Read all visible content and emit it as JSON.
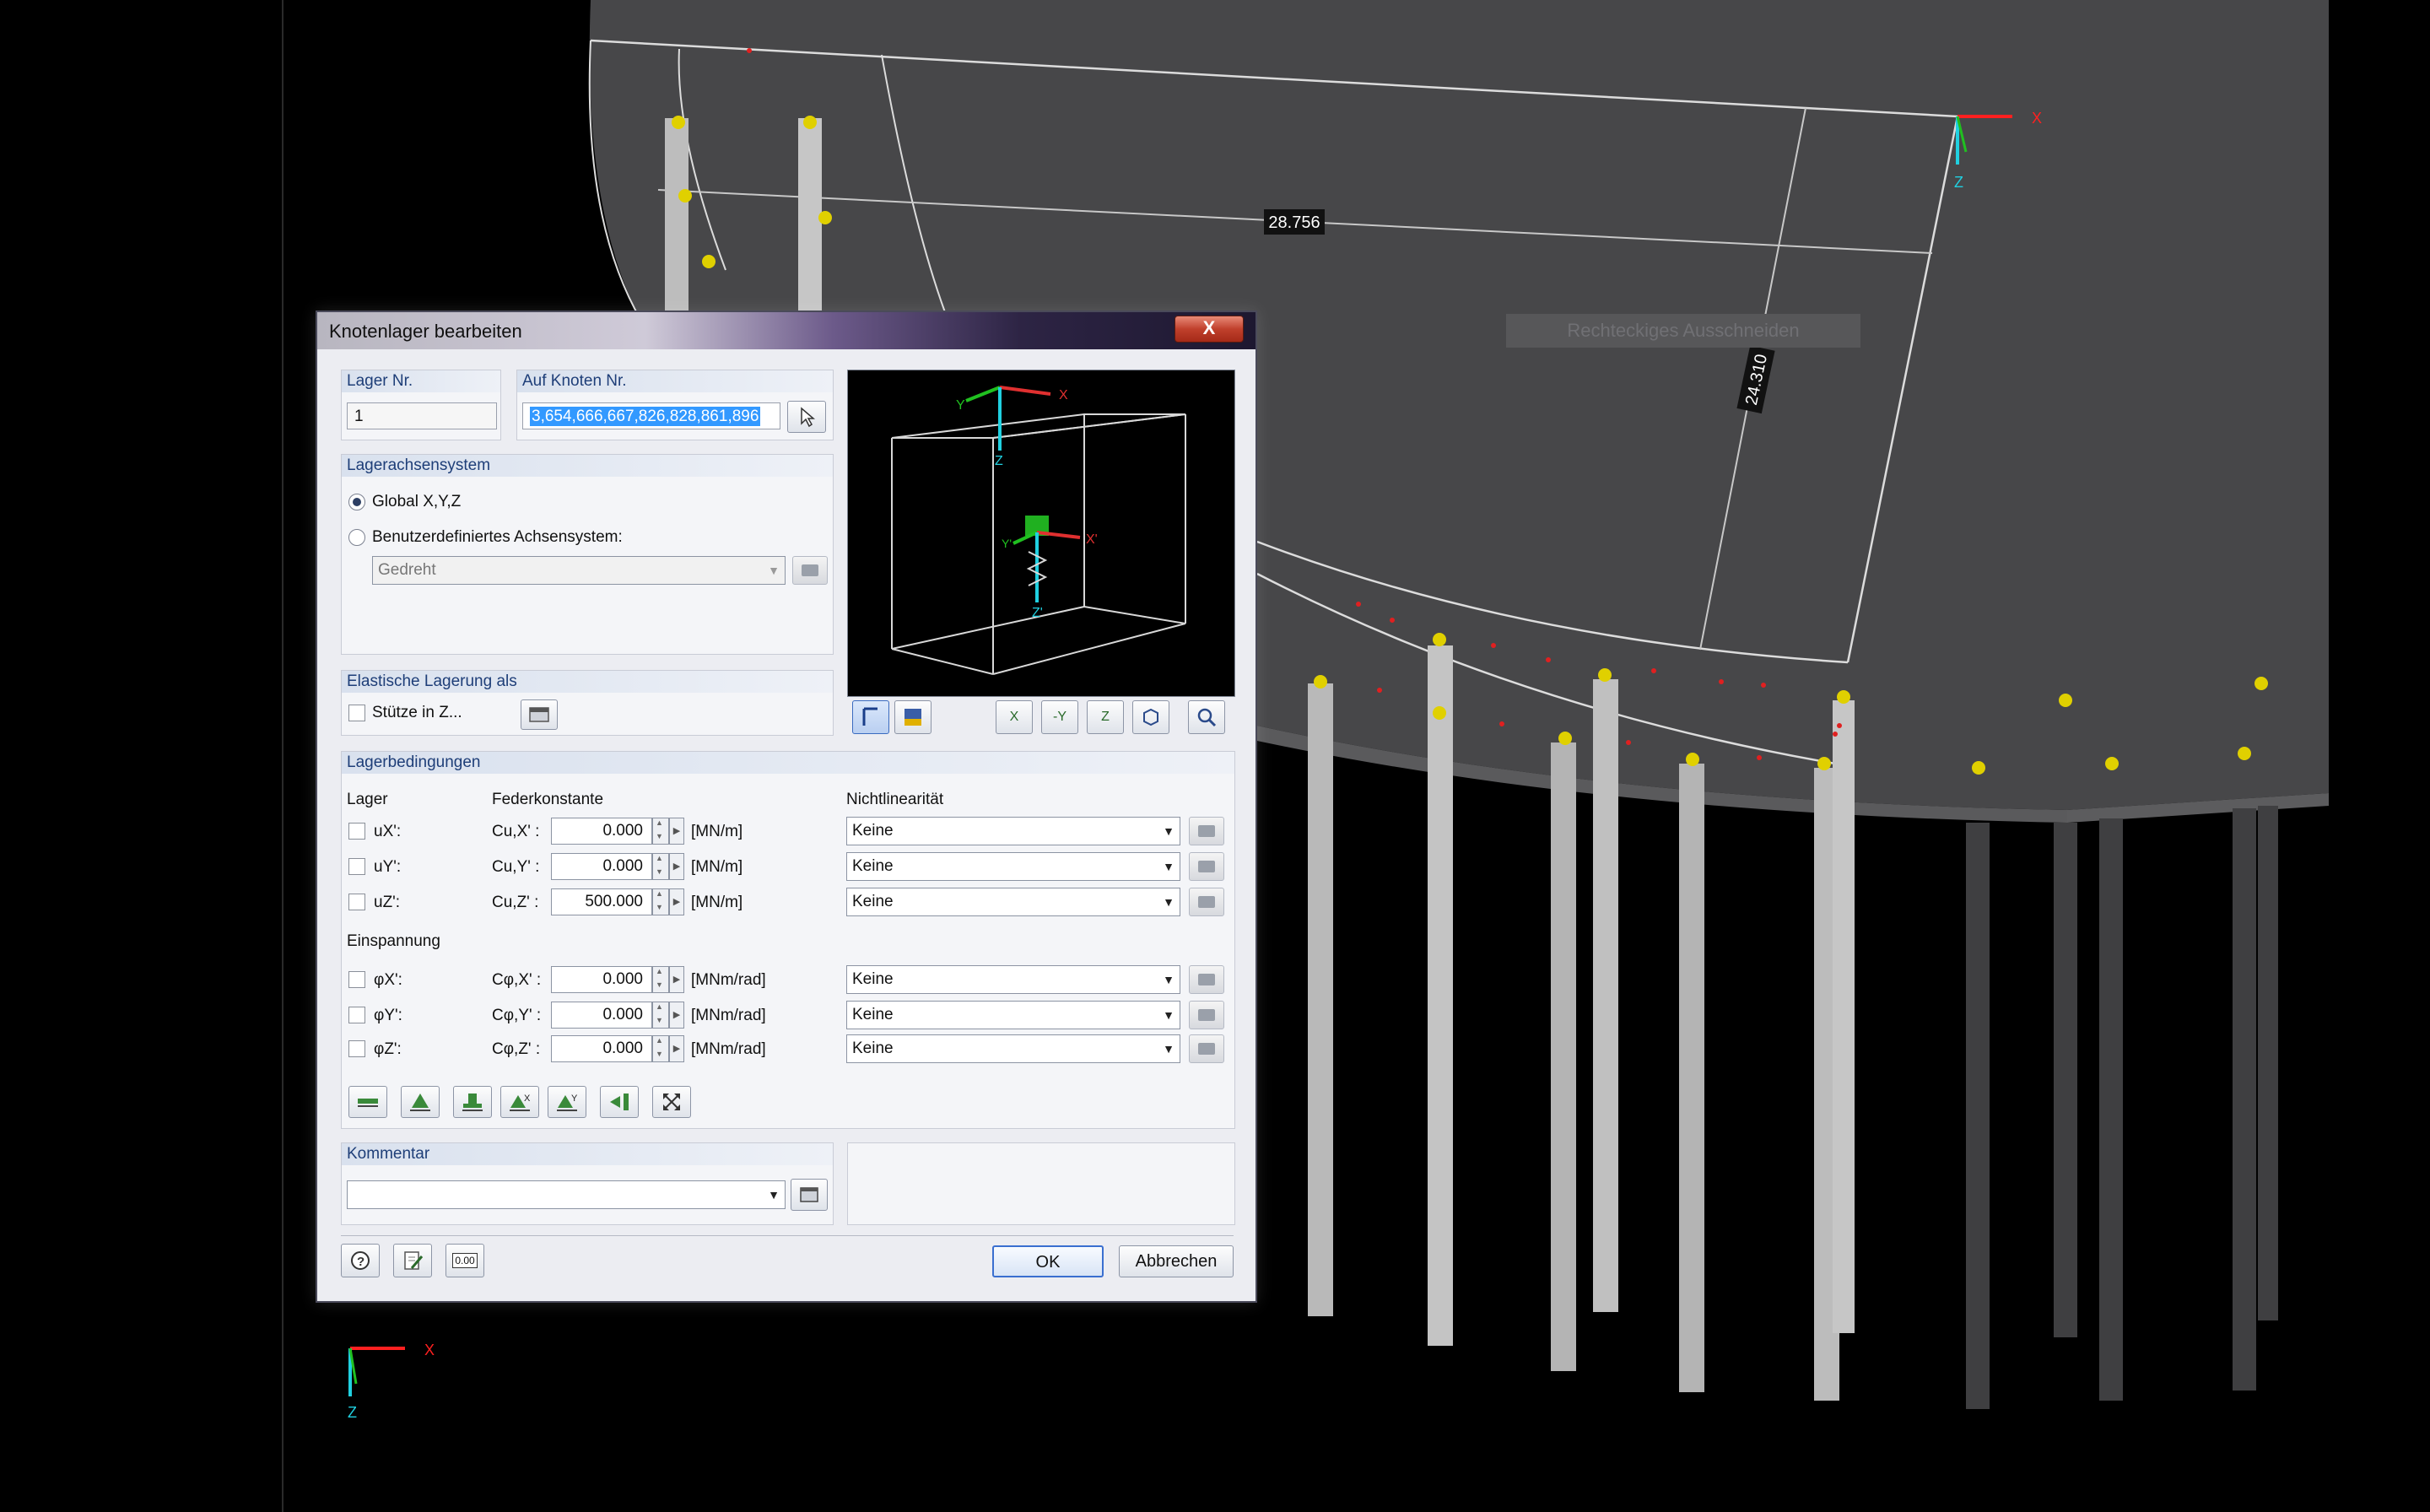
{
  "viewport": {
    "dimension_1": "28.756",
    "dimension_2": "24.310",
    "ghost_label": "Rechteckiges Ausschneiden",
    "axis_x": "X",
    "axis_z": "Z"
  },
  "dialog": {
    "title": "Knotenlager bearbeiten",
    "close": "X",
    "lager_nr": {
      "label": "Lager Nr.",
      "value": "1"
    },
    "auf_knoten": {
      "label": "Auf Knoten Nr.",
      "value": "3,654,666,667,826,828,861,896"
    },
    "lagerachsensystem": {
      "header": "Lagerachsensystem",
      "opt_global": "Global X,Y,Z",
      "opt_user": "Benutzerdefiniertes Achsensystem:",
      "select_value": "Gedreht"
    },
    "preview": {
      "x": "X",
      "y": "Y",
      "z": "Z",
      "xp": "X'",
      "yp": "Y'",
      "zp": "Z'"
    },
    "elastisch": {
      "header": "Elastische Lagerung als",
      "checkbox": "Stütze in Z..."
    },
    "view_buttons": [
      "X",
      "-Y",
      "Z"
    ],
    "lagerbedingungen": {
      "header": "Lagerbedingungen",
      "col_lager": "Lager",
      "col_feder": "Federkonstante",
      "col_nicht": "Nichtlinearität",
      "einspannung": "Einspannung",
      "rows": [
        {
          "lager": "uX':",
          "feder": "Cu,X' :",
          "value": "0.000",
          "unit": "[MN/m]",
          "nl": "Keine"
        },
        {
          "lager": "uY':",
          "feder": "Cu,Y' :",
          "value": "0.000",
          "unit": "[MN/m]",
          "nl": "Keine"
        },
        {
          "lager": "uZ':",
          "feder": "Cu,Z' :",
          "value": "500.000",
          "unit": "[MN/m]",
          "nl": "Keine"
        },
        {
          "lager": "φX':",
          "feder": "Cφ,X' :",
          "value": "0.000",
          "unit": "[MNm/rad]",
          "nl": "Keine"
        },
        {
          "lager": "φY':",
          "feder": "Cφ,Y' :",
          "value": "0.000",
          "unit": "[MNm/rad]",
          "nl": "Keine"
        },
        {
          "lager": "φZ':",
          "feder": "Cφ,Z' :",
          "value": "0.000",
          "unit": "[MNm/rad]",
          "nl": "Keine"
        }
      ]
    },
    "kommentar": {
      "header": "Kommentar",
      "value": ""
    },
    "footer": {
      "ok": "OK",
      "cancel": "Abbrechen",
      "num_icon": "0.00"
    }
  }
}
